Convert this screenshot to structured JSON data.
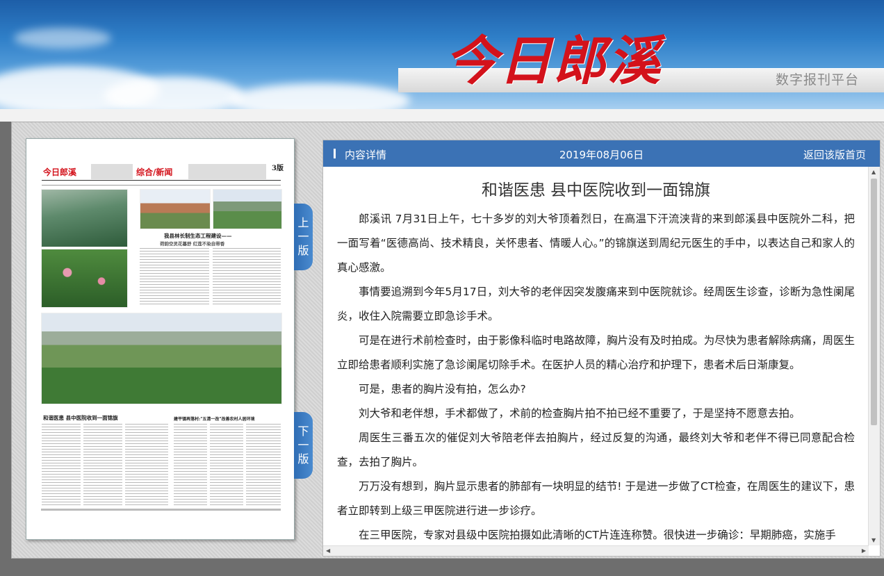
{
  "header": {
    "logo": "今日郎溪",
    "platform": "数字报刊平台"
  },
  "paper": {
    "logo": "今日郎溪",
    "section": "综合/新闻",
    "page_no": "3版",
    "headline_top": "我县林长制生态工程建设——",
    "subhead_top": "荷韵空灵花暮舒  红莲不染自带香",
    "headline_left": "和谐医患  县中医院收到一面锦旗",
    "headline_right": "建平镇再落村:\"五清一改\"改善农村人居环境"
  },
  "nav": {
    "prev_chars": [
      "上",
      "一",
      "版"
    ],
    "next_chars": [
      "下",
      "一",
      "版"
    ]
  },
  "panel": {
    "bar_title": "内容详情",
    "date": "2019年08月06日",
    "back": "返回该版首页"
  },
  "article": {
    "title": "和谐医患 县中医院收到一面锦旗",
    "paragraphs": [
      "郎溪讯 7月31日上午，七十多岁的刘大爷顶着烈日，在高温下汗流浃背的来到郎溪县中医院外二科，把一面写着“医德高尚、技术精良，关怀患者、情暖人心。”的锦旗送到周纪元医生的手中，以表达自己和家人的真心感激。",
      "事情要追溯到今年5月17日，刘大爷的老伴因突发腹痛来到中医院就诊。经周医生诊查，诊断为急性阑尾炎，收住入院需要立即急诊手术。",
      "可是在进行术前检查时，由于影像科临时电路故障，胸片没有及时拍成。为尽快为患者解除病痛，周医生立即给患者顺利实施了急诊阑尾切除手术。在医护人员的精心治疗和护理下，患者术后日渐康复。",
      "可是，患者的胸片没有拍，怎么办?",
      "刘大爷和老伴想，手术都做了，术前的检查胸片拍不拍已经不重要了，于是坚持不愿意去拍。",
      "周医生三番五次的催促刘大爷陪老伴去拍胸片，经过反复的沟通，最终刘大爷和老伴不得已同意配合检查，去拍了胸片。",
      "万万没有想到，胸片显示患者的肺部有一块明显的结节! 于是进一步做了CT检查，在周医生的建议下，患者立即转到上级三甲医院进行进一步诊疗。",
      "在三甲医院，专家对县级中医院拍摄如此清晰的CT片连连称赞。很快进一步确诊：早期肺癌，实施手"
    ]
  }
}
